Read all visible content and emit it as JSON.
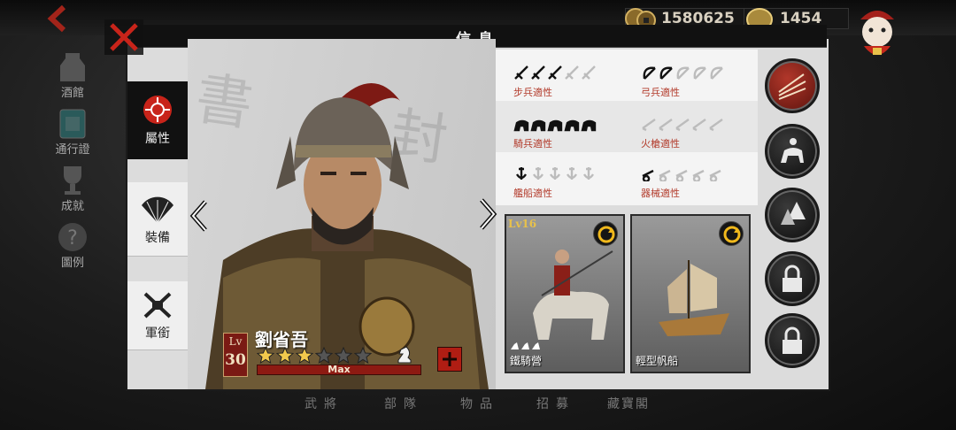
{
  "header": {
    "title": "信息",
    "gold": "1580625",
    "gems": "1454"
  },
  "left_nav": [
    {
      "label": "酒館",
      "icon": "wine-jug-icon"
    },
    {
      "label": "通行證",
      "icon": "pass-card-icon"
    },
    {
      "label": "成就",
      "icon": "trophy-icon"
    },
    {
      "label": "圖例",
      "icon": "question-icon"
    }
  ],
  "tabs": [
    {
      "label": "屬性",
      "icon": "attribute-flower-icon",
      "active": true
    },
    {
      "label": "裝備",
      "icon": "fan-icon",
      "active": false
    },
    {
      "label": "軍銜",
      "icon": "crossed-swords-icon",
      "active": false
    }
  ],
  "hero": {
    "lv_label": "Lv",
    "level": "30",
    "name": "劉省吾",
    "stars_filled": 3,
    "stars_total": 6,
    "max_label": "Max"
  },
  "aptitudes": [
    {
      "label": "步兵適性",
      "icon": "sword-icon",
      "filled": 3,
      "total": 5
    },
    {
      "label": "弓兵適性",
      "icon": "bow-icon",
      "filled": 2,
      "total": 5
    },
    {
      "label": "騎兵適性",
      "icon": "horse-icon",
      "filled": 5,
      "total": 5
    },
    {
      "label": "火槍適性",
      "icon": "musket-icon",
      "filled": 0,
      "total": 5
    },
    {
      "label": "艦船適性",
      "icon": "anchor-icon",
      "filled": 1,
      "total": 5
    },
    {
      "label": "器械適性",
      "icon": "cannon-icon",
      "filled": 1,
      "total": 5
    }
  ],
  "units": [
    {
      "name": "鐵騎營",
      "level_label": "Lv16",
      "stars": 3
    },
    {
      "name": "輕型帆船",
      "level_label": "",
      "stars": 0
    }
  ],
  "bottom_tabs": [
    {
      "label": "武將"
    },
    {
      "label": "部隊"
    },
    {
      "label": "物品"
    },
    {
      "label": "招募"
    },
    {
      "label": "藏寶閣"
    }
  ],
  "colors": {
    "accent_red": "#b01d13",
    "aptitude_label": "#b23a2a",
    "panel_bg": "#dcdcdc"
  }
}
